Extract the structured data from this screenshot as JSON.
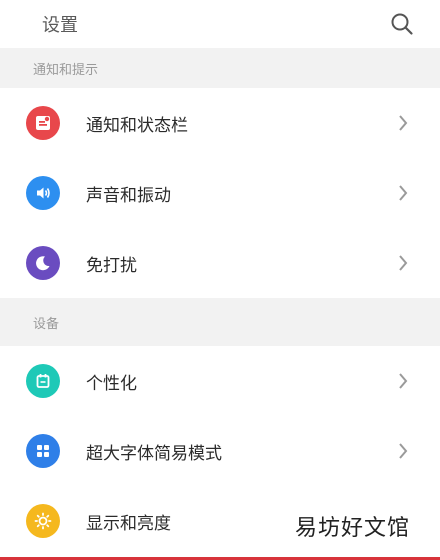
{
  "header": {
    "title": "设置",
    "search_icon": "search-icon"
  },
  "sections": [
    {
      "title": "通知和提示",
      "items": [
        {
          "label": "通知和状态栏",
          "icon": "notification-icon",
          "color": "#e8474b"
        },
        {
          "label": "声音和振动",
          "icon": "speaker-icon",
          "color": "#2d8ff0"
        },
        {
          "label": "免打扰",
          "icon": "moon-icon",
          "color": "#6a4cc0"
        }
      ]
    },
    {
      "title": "设备",
      "items": [
        {
          "label": "个性化",
          "icon": "personalize-icon",
          "color": "#1ec9b7"
        },
        {
          "label": "超大字体简易模式",
          "icon": "grid-icon",
          "color": "#2f7fe8"
        },
        {
          "label": "显示和亮度",
          "icon": "brightness-icon",
          "color": "#f5b81e"
        }
      ]
    }
  ],
  "watermark": "易坊好文馆",
  "colors": {
    "accent": "#d8343b",
    "section_bg": "#f2f2f2"
  }
}
